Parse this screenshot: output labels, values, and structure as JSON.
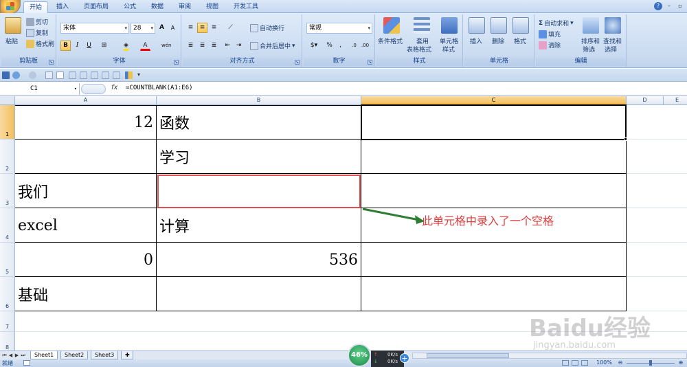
{
  "ribbon_tabs": [
    "开始",
    "插入",
    "页面布局",
    "公式",
    "数据",
    "审阅",
    "视图",
    "开发工具"
  ],
  "ribbon": {
    "clipboard": {
      "paste": "粘贴",
      "cut": "剪切",
      "copy": "复制",
      "format_painter": "格式刷",
      "label": "剪贴板"
    },
    "font": {
      "name": "宋体",
      "size": "28",
      "label": "字体",
      "bold": "B",
      "italic": "I",
      "underline": "U",
      "grow": "A",
      "shrink": "A",
      "color_a": "A",
      "phonetic": "wén"
    },
    "alignment": {
      "wrap": "自动换行",
      "merge": "合并后居中",
      "label": "对齐方式"
    },
    "number": {
      "format": "常规",
      "percent": "%",
      "comma": ",",
      "label": "数字"
    },
    "styles": {
      "conditional": "条件格式",
      "table": "套用\n表格格式",
      "table_line1": "套用",
      "table_line2": "表格格式",
      "cell_styles_line1": "单元格",
      "cell_styles_line2": "样式",
      "label": "样式"
    },
    "cells": {
      "insert": "插入",
      "delete": "删除",
      "format": "格式",
      "label": "单元格"
    },
    "editing": {
      "autosum": "自动求和",
      "fill": "填充",
      "clear": "清除",
      "sort_line1": "排序和",
      "sort_line2": "筛选",
      "find_line1": "查找和",
      "find_line2": "选择",
      "label": "编辑"
    }
  },
  "formula_bar": {
    "name_box": "C1",
    "fx": "fx",
    "formula": "=COUNTBLANK(A1:E6)"
  },
  "columns": [
    "A",
    "B",
    "C",
    "D",
    "E"
  ],
  "rows": [
    "1",
    "2",
    "3",
    "4",
    "5",
    "6",
    "7",
    "8"
  ],
  "cells": {
    "A1": "12",
    "B1": "函数",
    "B2": "学习",
    "A3": "我们",
    "A4": "excel",
    "B4": "计算",
    "A5": "0",
    "B5": "536",
    "A6": "基础"
  },
  "annotation": "此单元格中录入了一个空格",
  "sheet_tabs": [
    "Sheet1",
    "Sheet2",
    "Sheet3"
  ],
  "status": {
    "ready": "就绪",
    "zoom": "100%",
    "gauge": "46%",
    "net_up": "0K/s",
    "net_down": "0K/s"
  },
  "watermark": {
    "brand": "Baidu经验",
    "url": "jingyan.baidu.com"
  },
  "colors": {
    "accent": "#c6d9f1",
    "selection": "#f1c05c",
    "annotation": "#e03c3c",
    "arrow": "#2e7d32"
  }
}
